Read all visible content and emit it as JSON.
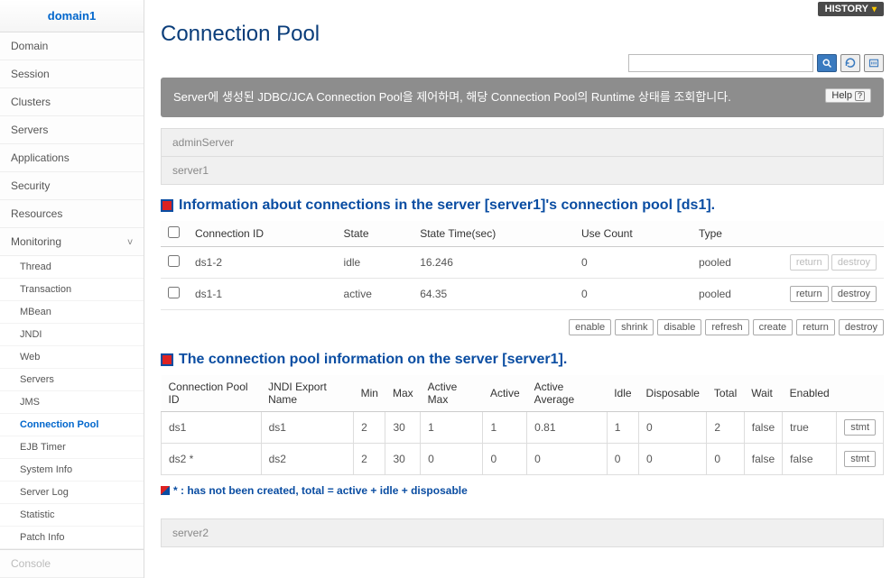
{
  "sidebar": {
    "header": "domain1",
    "items": [
      "Domain",
      "Session",
      "Clusters",
      "Servers",
      "Applications",
      "Security",
      "Resources"
    ],
    "monitoring_label": "Monitoring",
    "monitoring_items": [
      "Thread",
      "Transaction",
      "MBean",
      "JNDI",
      "Web",
      "Servers",
      "JMS",
      "Connection Pool",
      "EJB Timer",
      "System Info",
      "Server Log",
      "Statistic",
      "Patch Info"
    ],
    "console_label": "Console"
  },
  "topbar": {
    "history": "HISTORY"
  },
  "page": {
    "title": "Connection Pool",
    "description": "Server에 생성된 JDBC/JCA Connection Pool을 제어하며, 해당 Connection Pool의 Runtime 상태를 조회합니다.",
    "help_label": "Help",
    "server_context_1": "adminServer",
    "server_context_2": "server1",
    "server_context_3": "server2"
  },
  "section1": {
    "title": "Information about connections in the server [server1]'s connection pool [ds1].",
    "columns": [
      "Connection ID",
      "State",
      "State Time(sec)",
      "Use Count",
      "Type"
    ],
    "rows": [
      {
        "id": "ds1-2",
        "state": "idle",
        "state_time": "16.246",
        "use_count": "0",
        "type": "pooled",
        "return_disabled": true,
        "destroy_disabled": true
      },
      {
        "id": "ds1-1",
        "state": "active",
        "state_time": "64.35",
        "use_count": "0",
        "type": "pooled",
        "return_disabled": false,
        "destroy_disabled": false
      }
    ],
    "row_buttons": {
      "return": "return",
      "destroy": "destroy"
    }
  },
  "actions": {
    "enable": "enable",
    "shrink": "shrink",
    "disable": "disable",
    "refresh": "refresh",
    "create": "create",
    "return": "return",
    "destroy": "destroy"
  },
  "section2": {
    "title": "The connection pool information on the server [server1].",
    "columns": [
      "Connection Pool ID",
      "JNDI Export Name",
      "Min",
      "Max",
      "Active Max",
      "Active",
      "Active Average",
      "Idle",
      "Disposable",
      "Total",
      "Wait",
      "Enabled"
    ],
    "rows": [
      {
        "pool_id": "ds1",
        "jndi": "ds1",
        "min": "2",
        "max": "30",
        "active_max": "1",
        "active": "1",
        "active_avg": "0.81",
        "idle": "1",
        "disposable": "0",
        "total": "2",
        "wait": "false",
        "enabled": "true"
      },
      {
        "pool_id": "ds2 *",
        "jndi": "ds2",
        "min": "2",
        "max": "30",
        "active_max": "0",
        "active": "0",
        "active_avg": "0",
        "idle": "0",
        "disposable": "0",
        "total": "0",
        "wait": "false",
        "enabled": "false"
      }
    ],
    "stmt_label": "stmt"
  },
  "footnote": "* : has not been created, total = active + idle + disposable"
}
